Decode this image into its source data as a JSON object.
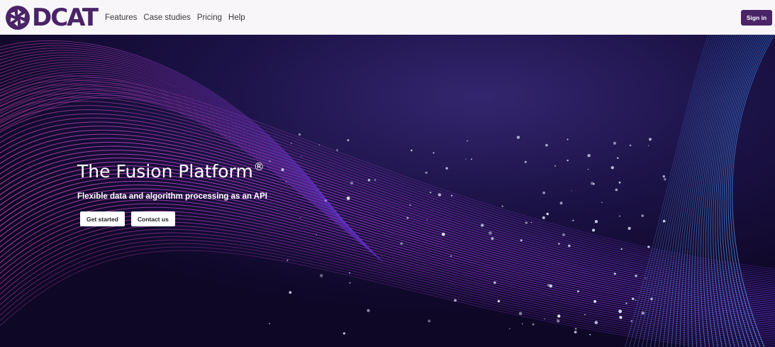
{
  "header": {
    "logo_text": "DCAT",
    "nav": [
      {
        "label": "Features"
      },
      {
        "label": "Case studies"
      },
      {
        "label": "Pricing"
      },
      {
        "label": "Help"
      }
    ],
    "sign_in_label": "Sign in"
  },
  "hero": {
    "title": "The Fusion Platform",
    "title_mark": "®",
    "subtitle": "Flexible data and algorithm processing as an API",
    "primary_button": "Get started",
    "secondary_button": "Contact us"
  },
  "colors": {
    "brand": "#4b2467",
    "hero_bg": "#1a1144",
    "wave_pink": "#e04bd8",
    "wave_violet": "#8a3cf0",
    "wave_blue": "#3d8ff0"
  },
  "icons": {
    "logo": "aperture-logo-icon"
  }
}
